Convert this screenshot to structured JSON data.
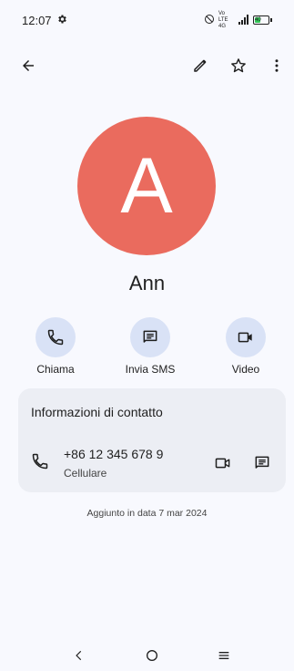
{
  "status_bar": {
    "time": "12:07",
    "network": "Vo LTE 4G",
    "battery": "40"
  },
  "toolbar": {
    "back_icon": "arrow-left-icon",
    "edit_icon": "pencil-icon",
    "favorite_icon": "star-outline-icon",
    "more_icon": "more-vert-icon"
  },
  "contact": {
    "initial": "A",
    "name": "Ann",
    "avatar_color": "#ea6b5e"
  },
  "actions": [
    {
      "label": "Chiama",
      "icon": "phone-icon"
    },
    {
      "label": "Invia SMS",
      "icon": "message-icon"
    },
    {
      "label": "Video",
      "icon": "videocam-icon"
    }
  ],
  "info_card": {
    "title": "Informazioni di contatto",
    "phone": {
      "number": "+86 12 345 678 9",
      "type": "Cellulare"
    }
  },
  "added_date": "Aggiunto in data 7 mar 2024",
  "colors": {
    "background": "#f8f9fe",
    "action_circle": "#d9e2f6",
    "card": "#eceef4"
  }
}
